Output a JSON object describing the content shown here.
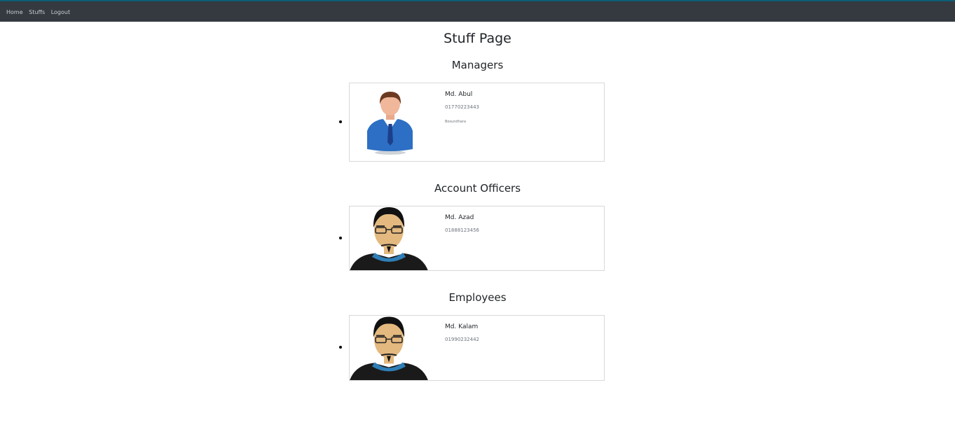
{
  "nav": {
    "items": [
      "Home",
      "Stuffs",
      "Logout"
    ]
  },
  "page": {
    "title": "Stuff Page"
  },
  "sections": [
    {
      "title": "Managers",
      "staff": {
        "name": "Md. Abul",
        "phone": "01770223443",
        "address": "Bosundhara",
        "avatar": "manager-avatar-icon"
      }
    },
    {
      "title": "Account Officers",
      "staff": {
        "name": "Md. Azad",
        "phone": "01888123456",
        "avatar": "man-glasses-avatar-icon"
      }
    },
    {
      "title": "Employees",
      "staff": {
        "name": "Md. Kalam",
        "phone": "01990232442",
        "avatar": "man-glasses-avatar-icon"
      }
    }
  ]
}
